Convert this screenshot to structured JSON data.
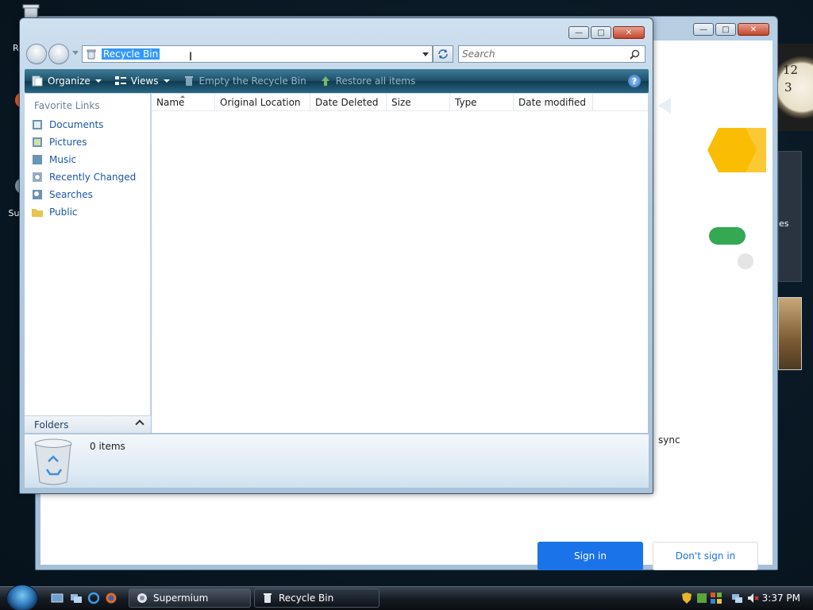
{
  "desktop": {
    "icons": [
      {
        "label": "Re"
      },
      {
        "label": "Sup"
      }
    ]
  },
  "background_window": {
    "sync_text": "sync",
    "sign_in_label": "Sign in",
    "dont_sign_in_label": "Don't sign in",
    "gadget_text": "es"
  },
  "explorer": {
    "address": "Recycle Bin",
    "search_placeholder": "Search",
    "toolbar": {
      "organize": "Organize",
      "views": "Views",
      "empty_bin": "Empty the Recycle Bin",
      "restore_all": "Restore all items"
    },
    "nav": {
      "header": "Favorite Links",
      "links": [
        "Documents",
        "Pictures",
        "Music",
        "Recently Changed",
        "Searches",
        "Public"
      ],
      "folders_label": "Folders"
    },
    "columns": [
      "Name",
      "Original Location",
      "Date Deleted",
      "Size",
      "Type",
      "Date modified"
    ],
    "details": {
      "count": "0 items"
    }
  },
  "taskbar": {
    "tasks": [
      {
        "label": "Supermium"
      },
      {
        "label": "Recycle Bin"
      }
    ],
    "clock": "3:37 PM"
  },
  "clock_gadget": {
    "numerals": [
      "12",
      "3"
    ]
  },
  "colors": {
    "accent": "#1a73e8",
    "selection": "#3399ff",
    "toolbar": "#1c4e66"
  }
}
